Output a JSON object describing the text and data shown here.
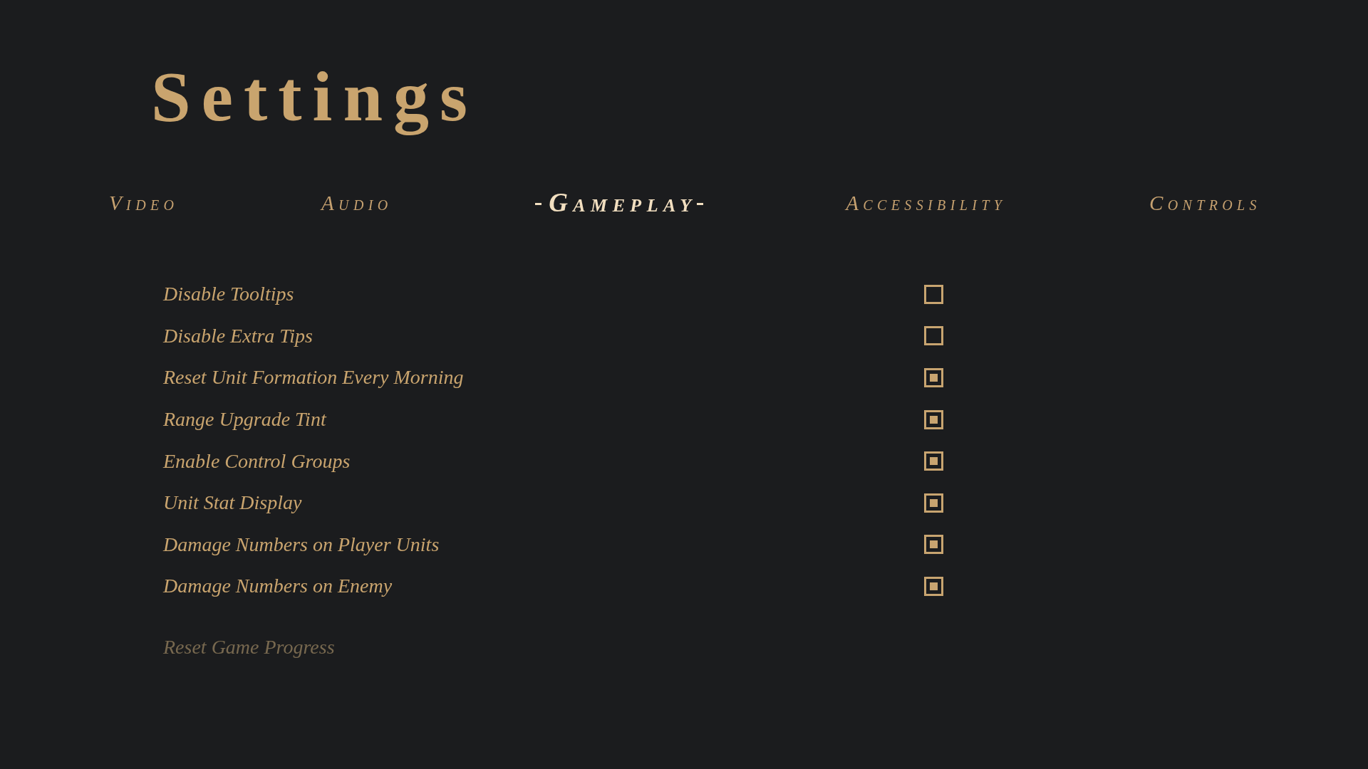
{
  "title": "Settings",
  "tabs": [
    {
      "label": "Video",
      "selected": false
    },
    {
      "label": "Audio",
      "selected": false
    },
    {
      "label": "Gameplay",
      "selected": true
    },
    {
      "label": "Accessibility",
      "selected": false
    },
    {
      "label": "Controls",
      "selected": false
    }
  ],
  "options": [
    {
      "label": "Disable Tooltips",
      "checked": false
    },
    {
      "label": "Disable Extra Tips",
      "checked": false
    },
    {
      "label": "Reset Unit Formation Every Morning",
      "checked": true
    },
    {
      "label": "Range Upgrade Tint",
      "checked": true
    },
    {
      "label": "Enable Control Groups",
      "checked": true
    },
    {
      "label": "Unit Stat Display",
      "checked": true
    },
    {
      "label": "Damage Numbers on Player Units",
      "checked": true
    },
    {
      "label": "Damage Numbers on Enemy",
      "checked": true
    }
  ],
  "reset_button": {
    "label": "Reset Game Progress",
    "disabled": true
  }
}
